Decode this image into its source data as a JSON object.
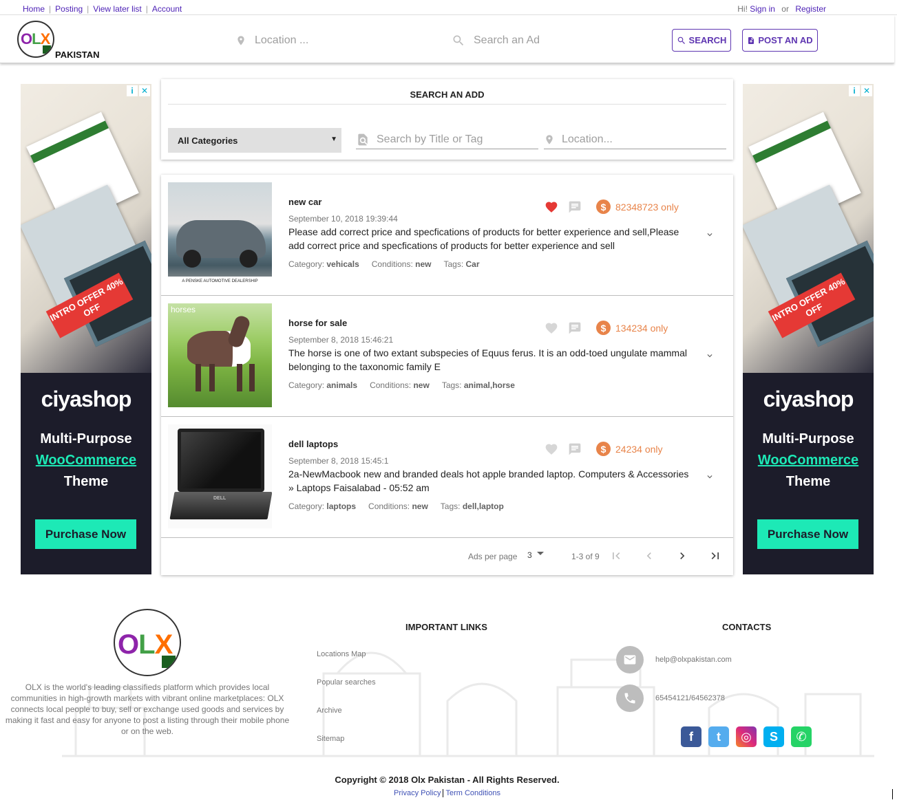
{
  "topnav": {
    "links": [
      "Home",
      "Posting",
      "View later list",
      "Account"
    ],
    "greeting": "Hi!",
    "sign_in": "Sign in",
    "or": "or",
    "register": "Register"
  },
  "header": {
    "logo_text": "OLX",
    "brand": "PAKISTAN",
    "location_placeholder": "Location ...",
    "search_placeholder": "Search an Ad",
    "search_button": "SEARCH",
    "post_button": "POST AN AD"
  },
  "ads": {
    "offer": "INTRO OFFER 40% OFF",
    "shop": "ciyashop",
    "line1": "Multi-Purpose",
    "line2": "WooCommerce",
    "line3": "Theme",
    "cta": "Purchase Now"
  },
  "search": {
    "title": "SEARCH AN ADD",
    "category": "All Categories",
    "title_placeholder": "Search by Title or Tag",
    "location_placeholder": "Location..."
  },
  "listings": [
    {
      "title": "new car",
      "date": "September 10, 2018 19:39:44",
      "description": "Please add correct price and specfications of products for better experience and sell,Please add correct price and specfications of products for better experience and sell",
      "category_label": "Category:",
      "category": "vehicals",
      "conditions_label": "Conditions:",
      "conditions": "new",
      "tags_label": "Tags:",
      "tags": "Car",
      "price": "82348723 only",
      "favorited": true,
      "image_caption": "A PENSKE AUTOMOTIVE DEALERSHIP"
    },
    {
      "title": "horse for sale",
      "date": "September 8, 2018 15:46:21",
      "description": "The horse is one of two extant subspecies of Equus ferus. It is an odd-toed ungulate mammal belonging to the taxonomic family E",
      "category_label": "Category:",
      "category": "animals",
      "conditions_label": "Conditions:",
      "conditions": "new",
      "tags_label": "Tags:",
      "tags": "animal,horse",
      "price": "134234 only",
      "favorited": false,
      "image_caption": "horses"
    },
    {
      "title": "dell laptops",
      "date": "September 8, 2018 15:45:1",
      "description": "2a-NewMacbook new and branded deals hot apple branded laptop. Computers & Accessories » Laptops Faisalabad - 05:52 am",
      "category_label": "Category:",
      "category": "laptops",
      "conditions_label": "Conditions:",
      "conditions": "new",
      "tags_label": "Tags:",
      "tags": "dell,laptop",
      "price": "24234 only",
      "favorited": false,
      "image_caption": "DELL"
    }
  ],
  "pagination": {
    "label": "Ads per page",
    "per_page": "3",
    "range": "1-3 of 9"
  },
  "footer": {
    "description": "OLX is the world's leading classifieds platform which provides local communities in high-growth markets with vibrant online marketplaces: OLX connects local people to buy, sell or exchange used goods and services by making it fast and easy for anyone to post a listing through their mobile phone or on the web.",
    "links_title": "IMPORTANT LINKS",
    "links": [
      "Locations Map",
      "Popular searches",
      "Archive",
      "Sitemap"
    ],
    "contacts_title": "CONTACTS",
    "email": "help@olxpakistan.com",
    "phone": "65454121/64562378",
    "social": [
      "facebook",
      "twitter",
      "instagram",
      "skype",
      "whatsapp"
    ],
    "copyright": "Copyright © 2018 Olx Pakistan - All Rights Reserved.",
    "privacy": "Privacy Policy",
    "terms": "Term Conditions"
  },
  "colors": {
    "accent": "#5e35b1",
    "link": "#4b1fb5",
    "price": "#e8844a",
    "heart_active": "#e53935",
    "heart_inactive": "#d6d6d6"
  }
}
